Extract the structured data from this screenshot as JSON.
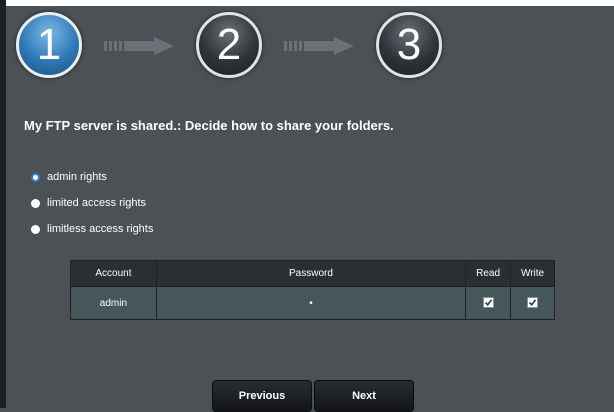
{
  "wizard": {
    "steps": [
      {
        "number": "1",
        "state": "active"
      },
      {
        "number": "2",
        "state": "inactive"
      },
      {
        "number": "3",
        "state": "inactive"
      }
    ]
  },
  "page": {
    "title": "My FTP server is shared.: Decide how to share your folders."
  },
  "access_options": [
    {
      "label": "admin rights",
      "selected": true
    },
    {
      "label": "limited access rights",
      "selected": false
    },
    {
      "label": "limitless access rights",
      "selected": false
    }
  ],
  "accounts_table": {
    "headers": {
      "account": "Account",
      "password": "Password",
      "read": "Read",
      "write": "Write"
    },
    "rows": [
      {
        "account": "admin",
        "password": "•",
        "read": true,
        "write": true
      }
    ]
  },
  "buttons": {
    "previous": "Previous",
    "next": "Next"
  },
  "colors": {
    "background": "#4b5154",
    "active_step": "#2f79b6",
    "radio_selected": "#2f7de1",
    "table_header": "#2a2f33",
    "table_row": "#46575b"
  }
}
